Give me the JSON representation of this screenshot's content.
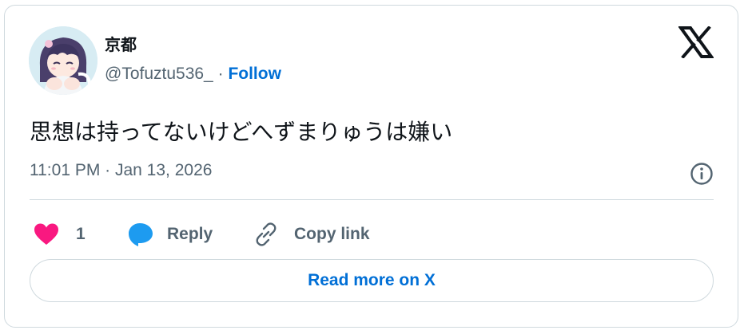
{
  "author": {
    "display_name": "京都",
    "handle": "@Tofuztu536_",
    "separator": "·",
    "follow_label": "Follow"
  },
  "tweet": {
    "text": "思想は持ってないけどへずまりゅうは嫌い",
    "timestamp": "11:01 PM · Jan 13, 2026"
  },
  "actions": {
    "like_count": "1",
    "reply_label": "Reply",
    "copy_link_label": "Copy link"
  },
  "read_more_label": "Read more on X",
  "colors": {
    "accent": "#006fd6",
    "like": "#f91880",
    "reply": "#1d9bf0",
    "muted_text": "#536471",
    "border": "#cfd9de"
  },
  "icons": {
    "platform_logo": "x-logo-icon",
    "info": "info-icon",
    "like": "heart-icon",
    "reply": "speech-bubble-icon",
    "copy_link": "link-icon"
  }
}
